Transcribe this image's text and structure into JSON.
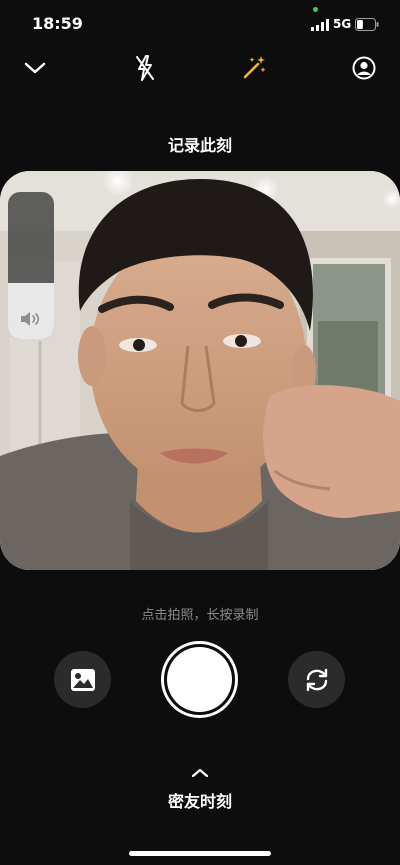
{
  "status_bar": {
    "time": "18:59",
    "network": "5G",
    "signal_bars": 4,
    "battery_level": 0.35
  },
  "toolbar": {
    "collapse_icon": "chevron-down-icon",
    "flash_icon": "flash-off-icon",
    "effects_icon": "magic-wand-icon",
    "profile_icon": "user-profile-icon",
    "accent_color": "#f2b233"
  },
  "page": {
    "title": "记录此刻",
    "hint": "点击拍照，长按录制"
  },
  "volume": {
    "level": 0.38,
    "icon": "speaker-icon"
  },
  "controls": {
    "gallery_icon": "image-gallery-icon",
    "shutter": "shutter-button",
    "flip_icon": "switch-camera-icon"
  },
  "moments": {
    "label": "密友时刻",
    "icon": "chevron-up-icon"
  }
}
